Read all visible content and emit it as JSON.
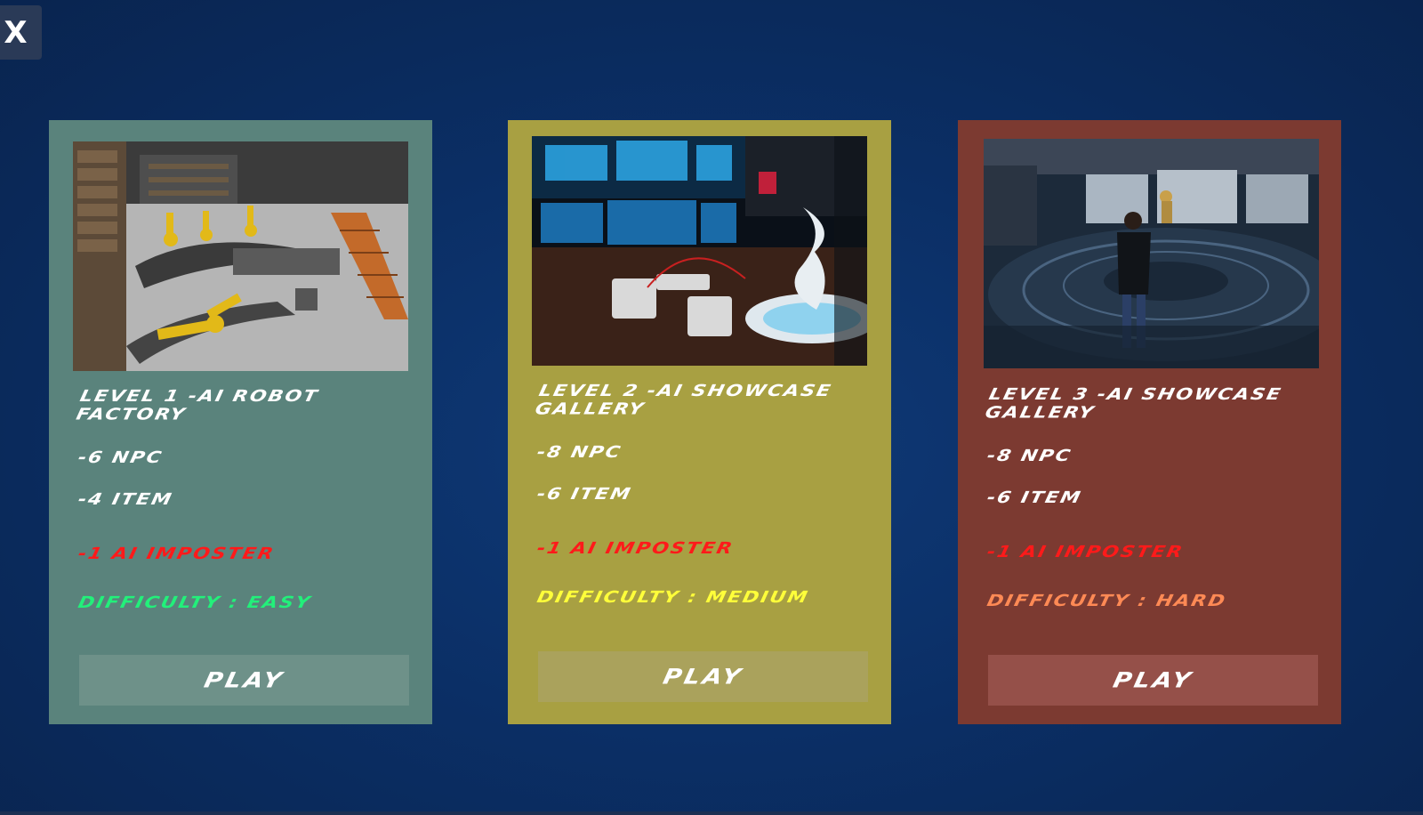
{
  "close_button": {
    "label": "X"
  },
  "colors": {
    "background": "#0b2f66",
    "card_easy": "#5a837c",
    "card_medium": "#a8a042",
    "card_hard": "#7c3a31",
    "imposter_text": "#ff1a1a",
    "difficulty_easy": "#22f07a",
    "difficulty_medium": "#ffff3a",
    "difficulty_hard": "#ff8a55"
  },
  "levels": [
    {
      "title": "LEVEL 1 -AI ROBOT FACTORY",
      "npc": "-6 NPC",
      "item": "-4 ITEM",
      "imposter": "-1 AI IMPOSTER",
      "difficulty": "DIFFICULTY : EASY",
      "play_label": "PLAY",
      "thumbnail_icon": "factory-scene-image"
    },
    {
      "title": "LEVEL 2 -AI SHOWCASE GALLERY",
      "npc": "-8 NPC",
      "item": "-6 ITEM",
      "imposter": "-1 AI IMPOSTER",
      "difficulty": "DIFFICULTY : MEDIUM",
      "play_label": "PLAY",
      "thumbnail_icon": "showcase-gallery-scene-image"
    },
    {
      "title": "LEVEL 3 -AI SHOWCASE GALLERY",
      "npc": "-8 NPC",
      "item": "-6 ITEM",
      "imposter": "-1 AI IMPOSTER",
      "difficulty": "DIFFICULTY : HARD",
      "play_label": "PLAY",
      "thumbnail_icon": "space-station-scene-image"
    }
  ]
}
